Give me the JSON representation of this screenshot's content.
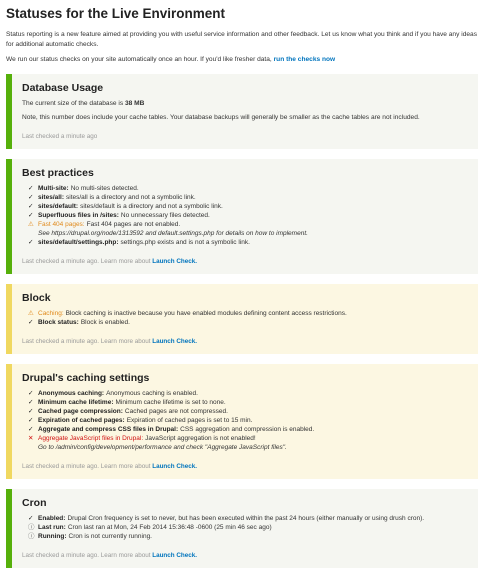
{
  "page": {
    "title": "Statuses for the Live Environment",
    "intro": "Status reporting is a new feature aimed at providing you with useful service information and other feedback. Let us know what you think and if you have any ideas for additional automatic checks.",
    "schedule_text": "We run our status checks on your site automatically once an hour. If you'd like fresher data,",
    "run_checks_link": "run the checks now"
  },
  "db": {
    "title": "Database Usage",
    "size_text": "The current size of the database is",
    "size_value": "38 MB",
    "note": "Note, this number does include your cache tables. Your database backups will generally be smaller as the cache tables are not included.",
    "last": "Last checked a minute ago"
  },
  "best": {
    "title": "Best practices",
    "items": [
      {
        "type": "ok",
        "label": "Multi-site:",
        "text": "No multi-sites detected."
      },
      {
        "type": "ok",
        "label": "sites/all:",
        "text": "sites/all is a directory and not a symbolic link."
      },
      {
        "type": "ok",
        "label": "sites/default:",
        "text": "sites/default is a directory and not a symbolic link."
      },
      {
        "type": "ok",
        "label": "Superfluous files in /sites:",
        "text": "No unnecessary files detected."
      },
      {
        "type": "warn",
        "label": "Fast 404 pages:",
        "text": "Fast 404 pages are not enabled.",
        "sub": "See https://drupal.org/node/1313592 and default.settings.php for details on how to implement."
      },
      {
        "type": "ok",
        "label": "sites/default/settings.php:",
        "text": "settings.php exists and is not a symbolic link."
      }
    ],
    "last": "Last checked a minute ago. Learn more about",
    "learn": "Launch Check."
  },
  "block": {
    "title": "Block",
    "items": [
      {
        "type": "warn",
        "label": "Caching:",
        "text": "Block caching is inactive because you have enabled modules defining content access restrictions."
      },
      {
        "type": "ok",
        "label": "Block status:",
        "text": "Block is enabled."
      }
    ],
    "last": "Last checked a minute ago. Learn more about",
    "learn": "Launch Check."
  },
  "caching": {
    "title": "Drupal's caching settings",
    "items": [
      {
        "type": "ok",
        "label": "Anonymous caching:",
        "text": "Anonymous caching is enabled."
      },
      {
        "type": "ok",
        "label": "Minimum cache lifetime:",
        "text": "Minimum cache lifetime is set to none."
      },
      {
        "type": "ok",
        "label": "Cached page compression:",
        "text": "Cached pages are not compressed."
      },
      {
        "type": "ok",
        "label": "Expiration of cached pages:",
        "text": "Expiration of cached pages is set to 15 min."
      },
      {
        "type": "ok",
        "label": "Aggregate and compress CSS files in Drupal:",
        "text": "CSS aggregation and compression is enabled."
      },
      {
        "type": "err",
        "label": "Aggregate JavaScript files in Drupal:",
        "text": "JavaScript aggregation is not enabled!",
        "sub": "Go to /admin/config/development/performance and check \"Aggregate JavaScript files\"."
      }
    ],
    "last": "Last checked a minute ago. Learn more about",
    "learn": "Launch Check."
  },
  "cron": {
    "title": "Cron",
    "items": [
      {
        "type": "ok",
        "label": "Enabled:",
        "text": "Drupal Cron frequency is set to never, but has been executed within the past 24 hours (either manually or using drush cron)."
      },
      {
        "type": "info",
        "label": "Last run:",
        "text": "Cron last ran at Mon, 24 Feb 2014 15:36:48 -0600 (25 min 46 sec ago)"
      },
      {
        "type": "info",
        "label": "Running:",
        "text": "Cron is not currently running."
      }
    ],
    "last": "Last checked a minute ago. Learn more about",
    "learn": "Launch Check."
  },
  "icons": {
    "ok": "✓",
    "warn": "⚠",
    "err": "✕",
    "info": "ⓘ"
  },
  "colors": {
    "pass_border": "#56b00b",
    "warn_border": "#f0d860",
    "link": "#0074bd",
    "warn_text": "#e08a1c",
    "error_text": "#d01010"
  }
}
